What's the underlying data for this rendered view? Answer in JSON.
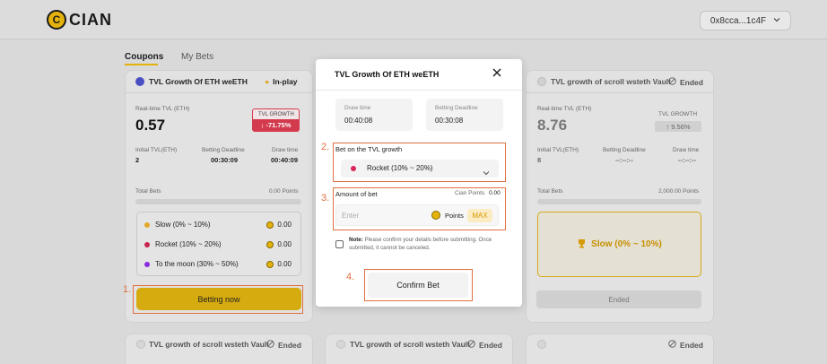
{
  "header": {
    "logo_mark": "C",
    "logo_text": "CIAN",
    "wallet_address": "0x8cca...1c4F"
  },
  "tabs": [
    {
      "label": "Coupons",
      "active": true
    },
    {
      "label": "My Bets",
      "active": false
    }
  ],
  "card_left": {
    "title": "TVL Growth Of ETH weETH",
    "status": "In-play",
    "realtime_label": "Real-time TVL (ETH)",
    "realtime_value": "0.57",
    "growth_label": "TVL GROWTH",
    "growth_value": "↓ -71.75%",
    "initial_label": "Initial TVL(ETH)",
    "initial_value": "2",
    "deadline_label": "Betting Deadline",
    "deadline_value": "00:30:09",
    "draw_label": "Draw time",
    "draw_value": "00:40:09",
    "total_bets_label": "Total Bets",
    "total_bets_value": "0.00 Points",
    "options": [
      {
        "label": "Slow (0% ~ 10%)",
        "value": "0.00",
        "color": "#e3a82a"
      },
      {
        "label": "Rocket (10% ~ 20%)",
        "value": "0.00",
        "color": "#c8234b"
      },
      {
        "label": "To the moon (30% ~ 50%)",
        "value": "0.00",
        "color": "#8a2be2"
      }
    ],
    "button": "Betting now"
  },
  "card_right": {
    "title": "TVL growth of scroll wsteth Vault",
    "status": "Ended",
    "realtime_label": "Real-time TVL (ETH)",
    "realtime_value": "8.76",
    "growth_label": "TVL GROWTH",
    "growth_value": "↑ 9.56%",
    "initial_label": "Initial TVL(ETH)",
    "initial_value": "8",
    "deadline_label": "Betting Deadline",
    "deadline_value": "--:--:--",
    "draw_label": "Draw time",
    "draw_value": "--:--:--",
    "total_bets_label": "Total Bets",
    "total_bets_value": "2,000.00 Points",
    "winner": "Slow (0% ~ 10%)",
    "button": "Ended"
  },
  "bottom_cards": [
    {
      "title": "TVL growth of scroll wsteth Vault",
      "status": "Ended"
    },
    {
      "title": "TVL growth of scroll wsteth Vault",
      "status": "Ended"
    },
    {
      "title": "",
      "status": "Ended"
    }
  ],
  "modal": {
    "title": "TVL Growth Of ETH weETH",
    "draw_time_label": "Draw time",
    "draw_time_value": "00:40:08",
    "deadline_label": "Betting Deadline",
    "deadline_value": "00:30:08",
    "bet_on_label": "Bet on the TVL growth",
    "selected_option": "Rocket (10% ~ 20%)",
    "selected_color": "#d8265a",
    "amount_label": "Amount of bet",
    "cian_points_label": "Cian Points",
    "cian_points_value": "0.00",
    "input_placeholder": "Enter",
    "points_label": "Points",
    "max_label": "MAX",
    "note_bold": "Note:",
    "note_text": "Please confirm your details before submitting. Once submitted, it cannot be canceled.",
    "confirm_button": "Confirm Bet"
  },
  "annotations": [
    "1.",
    "2.",
    "3.",
    "4."
  ],
  "colors": {
    "accent": "#e3b20b",
    "annotation": "#e07040",
    "negative": "#d43a4e"
  }
}
